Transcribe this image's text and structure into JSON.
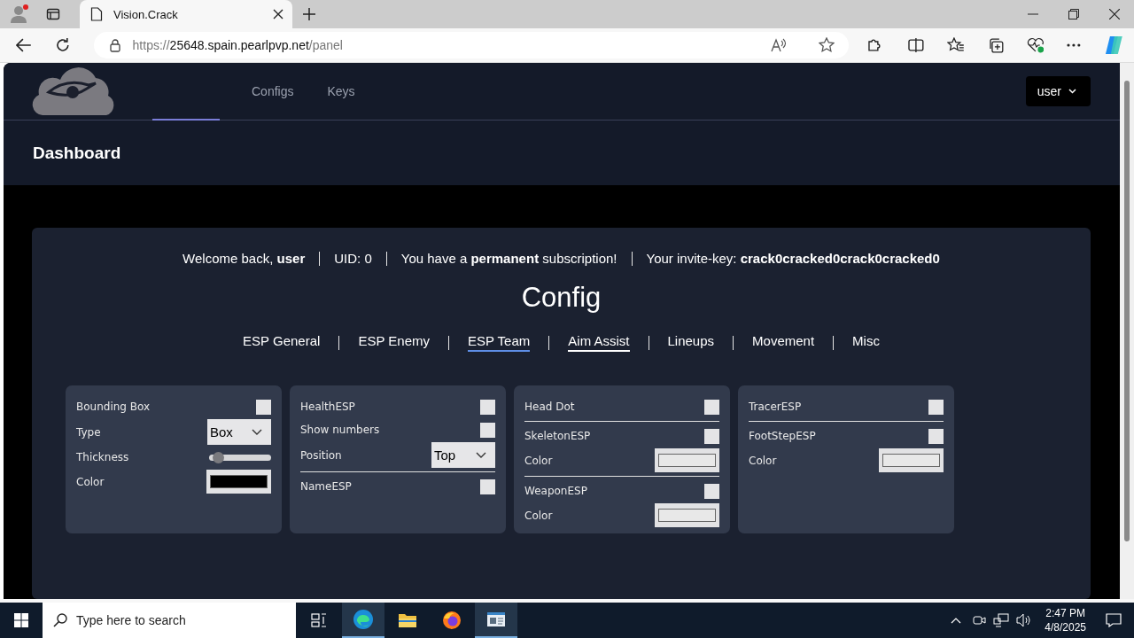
{
  "browser": {
    "tab_title": "Vision.Crack",
    "url": {
      "scheme": "https://",
      "host": "25648.spain.pearlpvp.net",
      "path": "/panel"
    }
  },
  "nav": {
    "items": [
      {
        "label": "Configs"
      },
      {
        "label": "Keys"
      }
    ],
    "user_menu": "user"
  },
  "header": {
    "title": "Dashboard"
  },
  "welcome": [
    {
      "text": "Welcome back, **user**"
    },
    {
      "text": "UID: 0"
    },
    {
      "text": "You have a **permanent** subscription!"
    },
    {
      "text": "Your invite-key: **crack0cracked0crack0cracked0**"
    }
  ],
  "config": {
    "title": "Config",
    "tabs": [
      {
        "label": "ESP General",
        "selected": false,
        "underlined": false
      },
      {
        "label": "ESP Enemy",
        "selected": false,
        "underlined": false
      },
      {
        "label": "ESP Team",
        "selected": true,
        "underlined": true
      },
      {
        "label": "Aim Assist",
        "selected": false,
        "underlined": true
      },
      {
        "label": "Lineups",
        "selected": false,
        "underlined": false
      },
      {
        "label": "Movement",
        "selected": false,
        "underlined": false
      },
      {
        "label": "Misc",
        "selected": false,
        "underlined": false
      }
    ],
    "cards": [
      {
        "rows": [
          {
            "kind": "checkbox",
            "label": "Bounding Box",
            "checked": false
          },
          {
            "kind": "select",
            "label": "Type",
            "value": "Box"
          },
          {
            "kind": "slider",
            "label": "Thickness",
            "level": 0.08
          },
          {
            "kind": "color",
            "label": "Color",
            "color": "#000000"
          }
        ]
      },
      {
        "rows": [
          {
            "kind": "checkbox",
            "label": "HealthESP",
            "checked": false
          },
          {
            "kind": "checkbox",
            "label": "Show numbers",
            "checked": false
          },
          {
            "kind": "select",
            "label": "Position",
            "value": "Top"
          },
          {
            "kind": "divider"
          },
          {
            "kind": "checkbox",
            "label": "NameESP",
            "checked": false
          }
        ]
      },
      {
        "rows": [
          {
            "kind": "checkbox",
            "label": "Head Dot",
            "checked": false
          },
          {
            "kind": "divider"
          },
          {
            "kind": "checkbox",
            "label": "SkeletonESP",
            "checked": false
          },
          {
            "kind": "color",
            "label": "Color",
            "color": "#e8e8e8"
          },
          {
            "kind": "divider"
          },
          {
            "kind": "checkbox",
            "label": "WeaponESP",
            "checked": false
          },
          {
            "kind": "color",
            "label": "Color",
            "color": "#e8e8e8"
          }
        ]
      },
      {
        "rows": [
          {
            "kind": "checkbox",
            "label": "TracerESP",
            "checked": false
          },
          {
            "kind": "divider"
          },
          {
            "kind": "checkbox",
            "label": "FootStepESP",
            "checked": false
          },
          {
            "kind": "color",
            "label": "Color",
            "color": "#e8e8e8"
          }
        ]
      }
    ]
  },
  "taskbar": {
    "search_placeholder": "Type here to search",
    "time": "2:47 PM",
    "date": "4/8/2025"
  }
}
